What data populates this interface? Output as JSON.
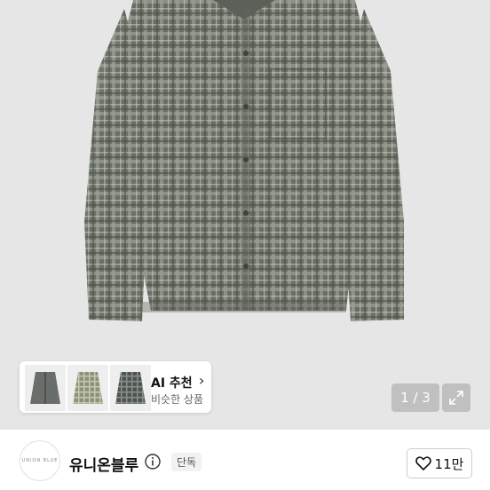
{
  "product_image": {
    "alt_icon": "plaid-shirt-image"
  },
  "ai_recommend": {
    "title": "AI 추천",
    "subtitle": "비슷한 상품",
    "thumbnails": [
      "thumbnail-1",
      "thumbnail-2",
      "thumbnail-3"
    ]
  },
  "gallery": {
    "counter": "1 / 3",
    "expand_icon": "expand-icon"
  },
  "store": {
    "logo_text": "UNION BLUE",
    "name": "유니온블루",
    "info_icon": "info-icon",
    "badge": "단독",
    "like_count": "11만",
    "like_icon": "heart-icon"
  },
  "colors": {
    "shirt_base": "#6f7469",
    "background": "#e6e6e6"
  }
}
